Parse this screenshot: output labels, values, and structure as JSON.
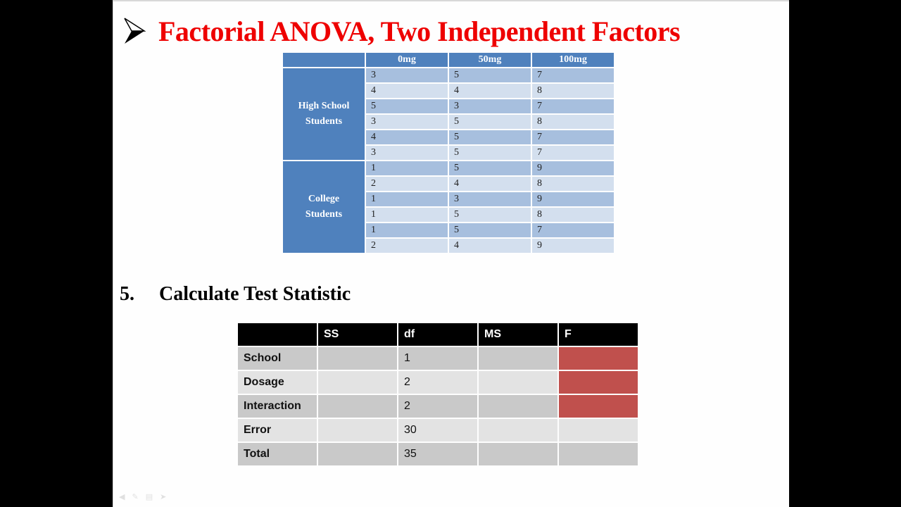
{
  "slide": {
    "title": "Factorial ANOVA, Two Independent Factors",
    "bullet_icon": "arrow-bullet-icon",
    "data_table": {
      "headers": [
        "",
        "0mg",
        "50mg",
        "100mg"
      ],
      "groups": [
        {
          "label": "High School Students",
          "rows": [
            [
              "3",
              "5",
              "7"
            ],
            [
              "4",
              "4",
              "8"
            ],
            [
              "5",
              "3",
              "7"
            ],
            [
              "3",
              "5",
              "8"
            ],
            [
              "4",
              "5",
              "7"
            ],
            [
              "3",
              "5",
              "7"
            ]
          ]
        },
        {
          "label": "College Students",
          "rows": [
            [
              "1",
              "5",
              "9"
            ],
            [
              "2",
              "4",
              "8"
            ],
            [
              "1",
              "3",
              "9"
            ],
            [
              "1",
              "5",
              "8"
            ],
            [
              "1",
              "5",
              "7"
            ],
            [
              "2",
              "4",
              "9"
            ]
          ]
        }
      ]
    },
    "section": {
      "number": "5.",
      "label": "Calculate Test Statistic"
    },
    "anova_table": {
      "headers": [
        "",
        "SS",
        "df",
        "MS",
        "F"
      ],
      "rows": [
        {
          "source": "School",
          "ss": "",
          "df": "1",
          "ms": "",
          "f": "",
          "f_highlight": true
        },
        {
          "source": "Dosage",
          "ss": "",
          "df": "2",
          "ms": "",
          "f": "",
          "f_highlight": true
        },
        {
          "source": "Interaction",
          "ss": "",
          "df": "2",
          "ms": "",
          "f": "",
          "f_highlight": true
        },
        {
          "source": "Error",
          "ss": "",
          "df": "30",
          "ms": "",
          "f": "",
          "f_highlight": false
        },
        {
          "source": "Total",
          "ss": "",
          "df": "35",
          "ms": "",
          "f": "",
          "f_highlight": false
        }
      ]
    },
    "colors": {
      "title": "#ee0000",
      "table_header": "#4f81bd",
      "f_highlight": "#c0504d"
    },
    "nav_icons": [
      "prev-slide-icon",
      "pen-icon",
      "slide-menu-icon",
      "next-slide-icon"
    ]
  }
}
